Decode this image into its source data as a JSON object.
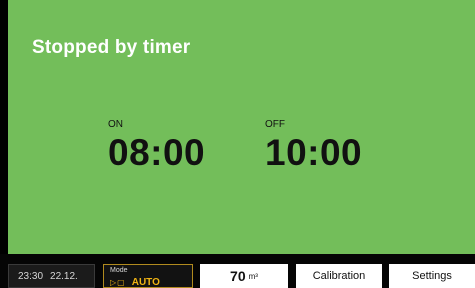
{
  "status": {
    "title": "Stopped by timer",
    "background_color": "#73be5a"
  },
  "timer": {
    "on": {
      "label": "ON",
      "time": "08:00"
    },
    "off": {
      "label": "OFF",
      "time": "10:00"
    }
  },
  "bottom_bar": {
    "clock": {
      "time": "23:30",
      "date": "22.12."
    },
    "mode": {
      "label": "Mode",
      "icon": "play-stop-icon",
      "icon_glyph": "▷▢",
      "value": "AUTO",
      "accent_color": "#f0b414"
    },
    "volume": {
      "value": "70",
      "unit": "m³"
    },
    "calibration_label": "Calibration",
    "settings_label": "Settings"
  }
}
